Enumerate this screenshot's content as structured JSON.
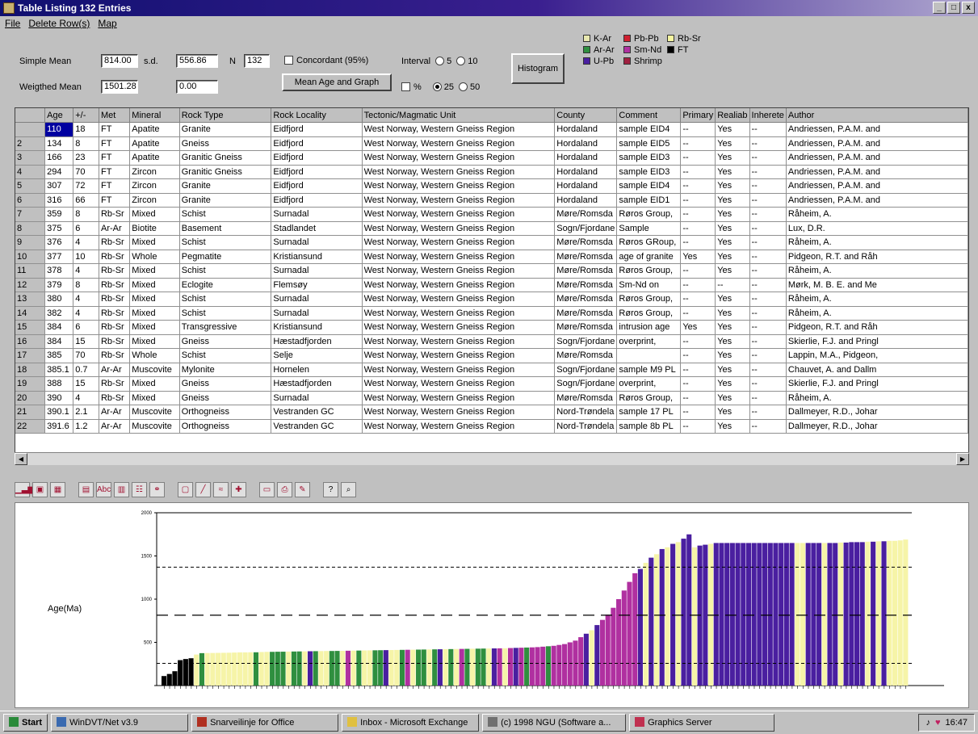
{
  "window": {
    "title": "Table Listing 132 Entries",
    "controls": [
      "_",
      "□",
      "x"
    ]
  },
  "menu": [
    "File",
    "Delete Row(s)",
    "Map"
  ],
  "stats": {
    "simple_mean_label": "Simple Mean",
    "simple_mean": "814.00",
    "sd_label": "s.d.",
    "sd": "556.86",
    "n_label": "N",
    "n": "132",
    "weighted_mean_label": "Weigthed Mean",
    "weighted_mean": "1501.28",
    "weighted_sd": "0.00",
    "concordant_label": "Concordant (95%)",
    "mean_age_button": "Mean Age and Graph",
    "interval_label": "Interval",
    "interval_options": [
      "5",
      "10",
      "25",
      "50"
    ],
    "interval_selected": "25",
    "percent_label": "%",
    "histogram_button": "Histogram"
  },
  "legend": [
    {
      "label": "K-Ar",
      "color": "#e8e8b0"
    },
    {
      "label": "Pb-Pb",
      "color": "#d02030"
    },
    {
      "label": "Rb-Sr",
      "color": "#f5f5a0"
    },
    {
      "label": "Ar-Ar",
      "color": "#2f8f3f"
    },
    {
      "label": "Sm-Nd",
      "color": "#b030a0"
    },
    {
      "label": "FT",
      "color": "#000000"
    },
    {
      "label": "U-Pb",
      "color": "#4a1fa0"
    },
    {
      "label": "Shrimp",
      "color": "#a02040"
    }
  ],
  "table": {
    "columns": [
      "",
      "Age",
      "+/-",
      "Met",
      "Mineral",
      "Rock Type",
      "Rock Locality",
      "Tectonic/Magmatic Unit",
      "County",
      "Comment",
      "Primary",
      "Realiab",
      "Inherete",
      "Author"
    ],
    "rows": [
      [
        "",
        "110",
        "18",
        "FT",
        "Apatite",
        "Granite",
        "Eidfjord",
        "West Norway, Western Gneiss Region",
        "Hordaland",
        "sample EID4",
        "--",
        "Yes",
        "--",
        "Andriessen, P.A.M. and"
      ],
      [
        "2",
        "134",
        "8",
        "FT",
        "Apatite",
        "Gneiss",
        "Eidfjord",
        "West Norway, Western Gneiss Region",
        "Hordaland",
        "sample EID5",
        "--",
        "Yes",
        "--",
        "Andriessen, P.A.M. and"
      ],
      [
        "3",
        "166",
        "23",
        "FT",
        "Apatite",
        "Granitic Gneiss",
        "Eidfjord",
        "West Norway, Western Gneiss Region",
        "Hordaland",
        "sample EID3",
        "--",
        "Yes",
        "--",
        "Andriessen, P.A.M. and"
      ],
      [
        "4",
        "294",
        "70",
        "FT",
        "Zircon",
        "Granitic Gneiss",
        "Eidfjord",
        "West Norway, Western Gneiss Region",
        "Hordaland",
        "sample EID3",
        "--",
        "Yes",
        "--",
        "Andriessen, P.A.M. and"
      ],
      [
        "5",
        "307",
        "72",
        "FT",
        "Zircon",
        "Granite",
        "Eidfjord",
        "West Norway, Western Gneiss Region",
        "Hordaland",
        "sample EID4",
        "--",
        "Yes",
        "--",
        "Andriessen, P.A.M. and"
      ],
      [
        "6",
        "316",
        "66",
        "FT",
        "Zircon",
        "Granite",
        "Eidfjord",
        "West Norway, Western Gneiss Region",
        "Hordaland",
        "sample EID1",
        "--",
        "Yes",
        "--",
        "Andriessen, P.A.M. and"
      ],
      [
        "7",
        "359",
        "8",
        "Rb-Sr",
        "Mixed",
        "Schist",
        "Surnadal",
        "West Norway, Western Gneiss Region",
        "Møre/Romsda",
        "Røros Group,",
        "--",
        "Yes",
        "--",
        "Råheim, A."
      ],
      [
        "8",
        "375",
        "6",
        "Ar-Ar",
        "Biotite",
        "Basement",
        "Stadlandet",
        "West Norway, Western Gneiss Region",
        "Sogn/Fjordane",
        "Sample",
        "--",
        "Yes",
        "--",
        "Lux, D.R."
      ],
      [
        "9",
        "376",
        "4",
        "Rb-Sr",
        "Mixed",
        "Schist",
        "Surnadal",
        "West Norway, Western Gneiss Region",
        "Møre/Romsda",
        "Røros GRoup,",
        "--",
        "Yes",
        "--",
        "Råheim, A."
      ],
      [
        "10",
        "377",
        "10",
        "Rb-Sr",
        "Whole",
        "Pegmatite",
        "Kristiansund",
        "West Norway, Western Gneiss Region",
        "Møre/Romsda",
        "age of granite",
        "Yes",
        "Yes",
        "--",
        "Pidgeon, R.T. and Råh"
      ],
      [
        "11",
        "378",
        "4",
        "Rb-Sr",
        "Mixed",
        "Schist",
        "Surnadal",
        "West Norway, Western Gneiss Region",
        "Møre/Romsda",
        "Røros Group,",
        "--",
        "Yes",
        "--",
        "Råheim, A."
      ],
      [
        "12",
        "379",
        "8",
        "Rb-Sr",
        "Mixed",
        "Eclogite",
        "Flemsøy",
        "West Norway, Western Gneiss Region",
        "Møre/Romsda",
        "Sm-Nd on",
        "--",
        "--",
        "--",
        "Mørk, M. B. E. and Me"
      ],
      [
        "13",
        "380",
        "4",
        "Rb-Sr",
        "Mixed",
        "Schist",
        "Surnadal",
        "West Norway, Western Gneiss Region",
        "Møre/Romsda",
        "Røros Group,",
        "--",
        "Yes",
        "--",
        "Råheim, A."
      ],
      [
        "14",
        "382",
        "4",
        "Rb-Sr",
        "Mixed",
        "Schist",
        "Surnadal",
        "West Norway, Western Gneiss Region",
        "Møre/Romsda",
        "Røros Group,",
        "--",
        "Yes",
        "--",
        "Råheim, A."
      ],
      [
        "15",
        "384",
        "6",
        "Rb-Sr",
        "Mixed",
        "Transgressive",
        "Kristiansund",
        "West Norway, Western Gneiss Region",
        "Møre/Romsda",
        "intrusion age",
        "Yes",
        "Yes",
        "--",
        "Pidgeon, R.T. and Råh"
      ],
      [
        "16",
        "384",
        "15",
        "Rb-Sr",
        "Mixed",
        "Gneiss",
        "Hæstadfjorden",
        "West Norway, Western Gneiss Region",
        "Sogn/Fjordane",
        "overprint,",
        "--",
        "Yes",
        "--",
        "Skierlie, F.J. and Pringl"
      ],
      [
        "17",
        "385",
        "70",
        "Rb-Sr",
        "Whole",
        "Schist",
        "Selje",
        "West Norway, Western Gneiss Region",
        "Møre/Romsda",
        "",
        "--",
        "Yes",
        "--",
        "Lappin, M.A., Pidgeon,"
      ],
      [
        "18",
        "385.1",
        "0.7",
        "Ar-Ar",
        "Muscovite",
        "Mylonite",
        "Hornelen",
        "West Norway, Western Gneiss Region",
        "Sogn/Fjordane",
        "sample M9 PL",
        "--",
        "Yes",
        "--",
        "Chauvet, A. and Dallm"
      ],
      [
        "19",
        "388",
        "15",
        "Rb-Sr",
        "Mixed",
        "Gneiss",
        "Hæstadfjorden",
        "West Norway, Western Gneiss Region",
        "Sogn/Fjordane",
        "overprint,",
        "--",
        "Yes",
        "--",
        "Skierlie, F.J. and Pringl"
      ],
      [
        "20",
        "390",
        "4",
        "Rb-Sr",
        "Mixed",
        "Gneiss",
        "Surnadal",
        "West Norway, Western Gneiss Region",
        "Møre/Romsda",
        "Røros Group,",
        "--",
        "Yes",
        "--",
        "Råheim, A."
      ],
      [
        "21",
        "390.1",
        "2.1",
        "Ar-Ar",
        "Muscovite",
        "Orthogneiss",
        "Vestranden GC",
        "West Norway, Western Gneiss Region",
        "Nord-Trøndela",
        "sample 17 PL",
        "--",
        "Yes",
        "--",
        "Dallmeyer, R.D., Johar"
      ],
      [
        "22",
        "391.6",
        "1.2",
        "Ar-Ar",
        "Muscovite",
        "Orthogneiss",
        "Vestranden GC",
        "West Norway, Western Gneiss Region",
        "Nord-Trøndela",
        "sample 8b PL",
        "--",
        "Yes",
        "--",
        "Dallmeyer, R.D., Johar"
      ]
    ]
  },
  "toolbar_icons": [
    "bar-chart-icon",
    "3d-chart-icon",
    "grid-chart-icon",
    "table-icon",
    "text-label-icon",
    "axis-icon",
    "gallery-icon",
    "palette-icon",
    "border-icon",
    "line-tool-icon",
    "series-icon",
    "marker-icon",
    "copy-icon",
    "print-icon",
    "edit-icon",
    "help-icon",
    "zoom-icon"
  ],
  "chart_data": {
    "type": "bar",
    "ylabel": "Age(Ma)",
    "ylim": [
      0,
      2000
    ],
    "y_ticks": [
      "2000",
      "1500",
      "1000",
      "500",
      ""
    ],
    "reference_lines": {
      "mean": 814,
      "plus_sd": 1370.86,
      "minus_sd": 257.14
    },
    "series_ages": [
      110,
      134,
      166,
      294,
      307,
      316,
      359,
      375,
      376,
      377,
      378,
      379,
      380,
      382,
      384,
      384,
      385,
      385.1,
      388,
      390,
      390.1,
      391.6,
      392,
      393,
      394,
      395,
      396,
      397,
      398,
      399,
      400,
      400,
      401,
      402,
      403,
      404,
      405,
      406,
      407,
      408,
      409,
      410,
      411,
      412,
      413,
      414,
      415,
      416,
      417,
      418,
      419,
      420,
      421,
      422,
      423,
      424,
      425,
      426,
      427,
      428,
      429,
      430,
      431,
      432,
      434,
      436,
      438,
      440,
      442,
      445,
      450,
      455,
      460,
      470,
      480,
      500,
      520,
      560,
      600,
      640,
      700,
      760,
      820,
      900,
      1000,
      1100,
      1200,
      1300,
      1350,
      1420,
      1480,
      1520,
      1580,
      1600,
      1640,
      1660,
      1700,
      1750,
      1600,
      1620,
      1630,
      1640,
      1650,
      1650,
      1650,
      1650,
      1650,
      1650,
      1650,
      1650,
      1650,
      1650,
      1650,
      1650,
      1650,
      1650,
      1650,
      1650,
      1650,
      1650,
      1650,
      1650,
      1650,
      1650,
      1650,
      1655,
      1655,
      1660,
      1660,
      1660,
      1665,
      1665,
      1670,
      1670,
      1675,
      1675,
      1680,
      1690
    ],
    "series_methods": [
      "FT",
      "FT",
      "FT",
      "FT",
      "FT",
      "FT",
      "Rb-Sr",
      "Ar-Ar",
      "Rb-Sr",
      "Rb-Sr",
      "Rb-Sr",
      "Rb-Sr",
      "Rb-Sr",
      "Rb-Sr",
      "Rb-Sr",
      "Rb-Sr",
      "Rb-Sr",
      "Ar-Ar",
      "Rb-Sr",
      "Rb-Sr",
      "Ar-Ar",
      "Ar-Ar",
      "Ar-Ar",
      "Rb-Sr",
      "Ar-Ar",
      "Ar-Ar",
      "Rb-Sr",
      "U-Pb",
      "Ar-Ar",
      "Rb-Sr",
      "Rb-Sr",
      "Ar-Ar",
      "Ar-Ar",
      "Rb-Sr",
      "Sm-Nd",
      "Rb-Sr",
      "Ar-Ar",
      "Rb-Sr",
      "Rb-Sr",
      "Ar-Ar",
      "Ar-Ar",
      "U-Pb",
      "Rb-Sr",
      "Rb-Sr",
      "Ar-Ar",
      "Sm-Nd",
      "Rb-Sr",
      "Ar-Ar",
      "Ar-Ar",
      "Rb-Sr",
      "Ar-Ar",
      "U-Pb",
      "Rb-Sr",
      "Ar-Ar",
      "Rb-Sr",
      "Sm-Nd",
      "Ar-Ar",
      "Rb-Sr",
      "Ar-Ar",
      "Ar-Ar",
      "Rb-Sr",
      "U-Pb",
      "Sm-Nd",
      "Rb-Sr",
      "Sm-Nd",
      "U-Pb",
      "Sm-Nd",
      "Ar-Ar",
      "Sm-Nd",
      "Sm-Nd",
      "Sm-Nd",
      "Ar-Ar",
      "Sm-Nd",
      "Sm-Nd",
      "Sm-Nd",
      "Sm-Nd",
      "Sm-Nd",
      "Sm-Nd",
      "U-Pb",
      "Rb-Sr",
      "U-Pb",
      "Sm-Nd",
      "Sm-Nd",
      "Sm-Nd",
      "Sm-Nd",
      "Sm-Nd",
      "Sm-Nd",
      "Sm-Nd",
      "U-Pb",
      "Rb-Sr",
      "U-Pb",
      "Rb-Sr",
      "U-Pb",
      "Rb-Sr",
      "U-Pb",
      "Rb-Sr",
      "U-Pb",
      "U-Pb",
      "Rb-Sr",
      "U-Pb",
      "U-Pb",
      "Rb-Sr",
      "U-Pb",
      "U-Pb",
      "U-Pb",
      "U-Pb",
      "U-Pb",
      "U-Pb",
      "U-Pb",
      "U-Pb",
      "U-Pb",
      "U-Pb",
      "U-Pb",
      "U-Pb",
      "U-Pb",
      "U-Pb",
      "U-Pb",
      "Rb-Sr",
      "Rb-Sr",
      "U-Pb",
      "U-Pb",
      "U-Pb",
      "Rb-Sr",
      "U-Pb",
      "U-Pb",
      "Rb-Sr",
      "U-Pb",
      "U-Pb",
      "U-Pb",
      "U-Pb",
      "Rb-Sr",
      "U-Pb",
      "Rb-Sr",
      "U-Pb"
    ]
  },
  "taskbar": {
    "start": "Start",
    "tasks": [
      "WinDVT/Net v3.9",
      "Snarveilinje for Office",
      "Inbox - Microsoft Exchange",
      "(c) 1998 NGU (Software a...",
      "Graphics Server"
    ],
    "clock": "16:47"
  }
}
